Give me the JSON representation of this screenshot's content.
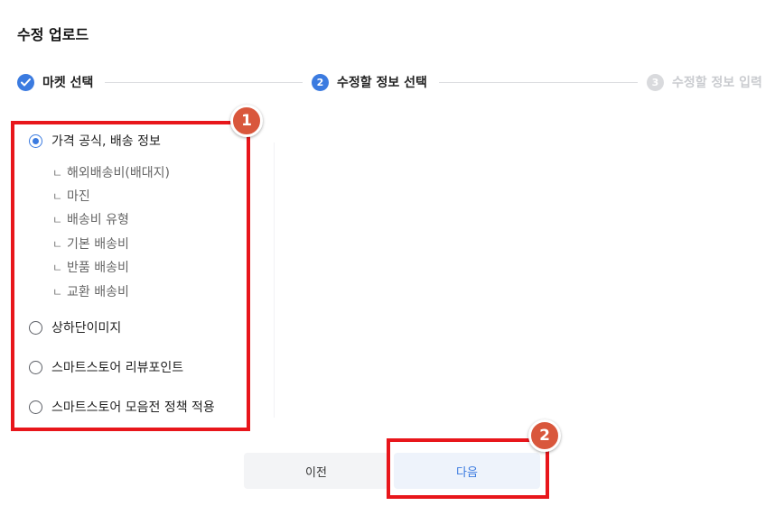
{
  "header": {
    "title": "수정 업로드"
  },
  "steps": [
    {
      "number": "1",
      "label": "마켓 선택",
      "state": "done",
      "icon": "check-icon"
    },
    {
      "number": "2",
      "label": "수정할 정보 선택",
      "state": "active"
    },
    {
      "number": "3",
      "label": "수정할 정보 입력",
      "state": "pending"
    }
  ],
  "options": [
    {
      "label": "가격 공식, 배송 정보",
      "checked": true,
      "sub_marker": "ㄴ",
      "sub_items": [
        "해외배송비(배대지)",
        "마진",
        "배송비 유형",
        "기본 배송비",
        "반품 배송비",
        "교환 배송비"
      ]
    },
    {
      "label": "상하단이미지",
      "checked": false
    },
    {
      "label": "스마트스토어 리뷰포인트",
      "checked": false
    },
    {
      "label": "스마트스토어 모음전 정책 적용",
      "checked": false
    }
  ],
  "annotations": {
    "badge_1": "1",
    "badge_2": "2",
    "highlight_color": "#e8161b",
    "badge_color": "#d9573c"
  },
  "buttons": {
    "prev_label": "이전",
    "next_label": "다음"
  },
  "colors": {
    "accent": "#3b7be0",
    "pending": "#d9dadd"
  }
}
